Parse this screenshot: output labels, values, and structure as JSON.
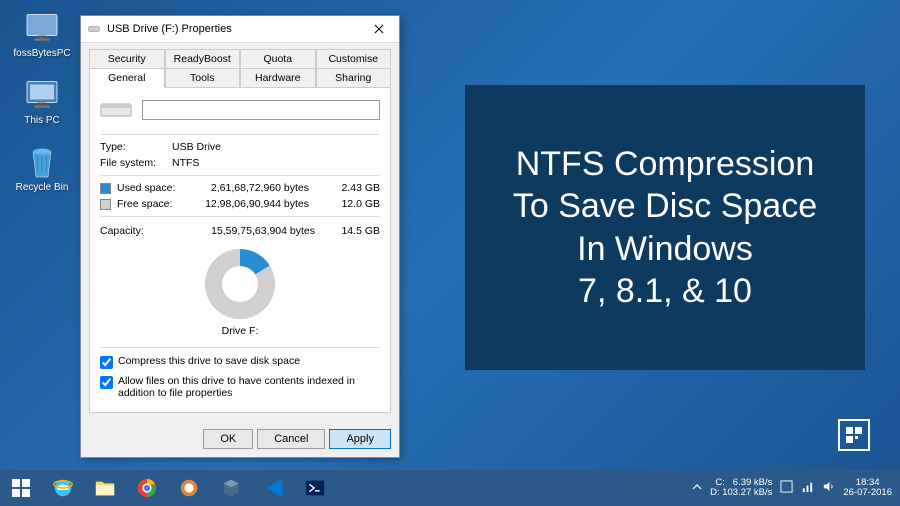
{
  "desktop": {
    "icons": [
      {
        "label": "fossBytesPC"
      },
      {
        "label": "This PC"
      },
      {
        "label": "Recycle Bin"
      }
    ]
  },
  "window": {
    "title": "USB Drive (F:) Properties",
    "tabs_top": [
      "Security",
      "ReadyBoost",
      "Quota",
      "Customise"
    ],
    "tabs_bottom": [
      "General",
      "Tools",
      "Hardware",
      "Sharing"
    ],
    "active_tab": "General",
    "drive_name": "",
    "type_label": "Type:",
    "type_value": "USB Drive",
    "fs_label": "File system:",
    "fs_value": "NTFS",
    "used_label": "Used space:",
    "used_bytes": "2,61,68,72,960 bytes",
    "used_gb": "2.43 GB",
    "free_label": "Free space:",
    "free_bytes": "12,98,06,90,944 bytes",
    "free_gb": "12.0 GB",
    "capacity_label": "Capacity:",
    "capacity_bytes": "15,59,75,63,904 bytes",
    "capacity_gb": "14.5 GB",
    "drive_label": "Drive F:",
    "checkbox1": "Compress this drive to save disk space",
    "checkbox2": "Allow files on this drive to have contents indexed in addition to file properties",
    "btn_ok": "OK",
    "btn_cancel": "Cancel",
    "btn_apply": "Apply"
  },
  "panel": {
    "line1": "NTFS Compression",
    "line2": "To Save Disc Space",
    "line3": "In Windows",
    "line4": "7, 8.1, & 10"
  },
  "taskbar": {
    "net_c": "C:",
    "net_d": "D:",
    "net_down": "6.39 kB/s",
    "net_up": "103.27 kB/s",
    "time": "18:34",
    "date": "26-07-2016"
  }
}
